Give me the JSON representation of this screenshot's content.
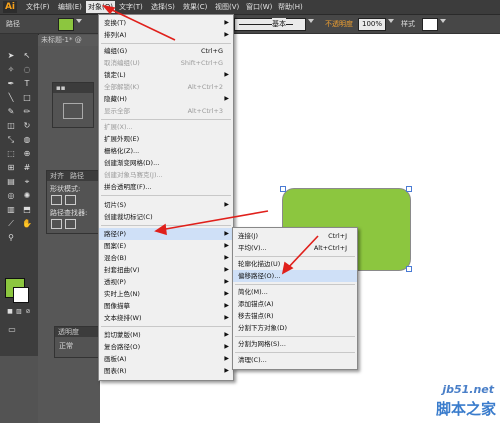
{
  "app": {
    "logo": "Ai"
  },
  "menubar": [
    {
      "label": "文件(F)"
    },
    {
      "label": "编辑(E)"
    },
    {
      "label": "对象(O)"
    },
    {
      "label": "文字(T)"
    },
    {
      "label": "选择(S)"
    },
    {
      "label": "效果(C)"
    },
    {
      "label": "视图(V)"
    },
    {
      "label": "窗口(W)"
    },
    {
      "label": "帮助(H)"
    }
  ],
  "controlbar": {
    "object_type": "路径",
    "stroke_style": "基本",
    "opacity_label": "不透明度",
    "opacity_value": "100%",
    "style_label": "样式"
  },
  "document": {
    "tab_title": "未标题-1* @"
  },
  "panels": {
    "shape_mode_label": "形状模式:",
    "pathfinder_label": "路径查找器:",
    "align_tab": "对齐",
    "path_tab": "路径",
    "transparency_tab": "透明度",
    "blend_mode": "正常"
  },
  "object_menu": {
    "items": [
      {
        "label": "变换(T)",
        "shortcut": "",
        "submenu": true,
        "disabled": false
      },
      {
        "label": "排列(A)",
        "shortcut": "",
        "submenu": true,
        "disabled": false
      },
      {
        "label": "编组(G)",
        "shortcut": "Ctrl+G",
        "submenu": false,
        "disabled": false
      },
      {
        "label": "取消编组(U)",
        "shortcut": "Shift+Ctrl+G",
        "submenu": false,
        "disabled": true
      },
      {
        "label": "锁定(L)",
        "shortcut": "",
        "submenu": true,
        "disabled": false
      },
      {
        "label": "全部解锁(K)",
        "shortcut": "Alt+Ctrl+2",
        "submenu": false,
        "disabled": true
      },
      {
        "label": "隐藏(H)",
        "shortcut": "",
        "submenu": true,
        "disabled": false
      },
      {
        "label": "显示全部",
        "shortcut": "Alt+Ctrl+3",
        "submenu": false,
        "disabled": true
      },
      {
        "label": "扩展(X)...",
        "shortcut": "",
        "submenu": false,
        "disabled": true
      },
      {
        "label": "扩展外观(E)",
        "shortcut": "",
        "submenu": false,
        "disabled": false
      },
      {
        "label": "栅格化(Z)...",
        "shortcut": "",
        "submenu": false,
        "disabled": false
      },
      {
        "label": "创建渐变网格(D)...",
        "shortcut": "",
        "submenu": false,
        "disabled": false
      },
      {
        "label": "创建对象马赛克(J)...",
        "shortcut": "",
        "submenu": false,
        "disabled": true
      },
      {
        "label": "拼合透明度(F)...",
        "shortcut": "",
        "submenu": false,
        "disabled": false
      },
      {
        "label": "切片(S)",
        "shortcut": "",
        "submenu": true,
        "disabled": false
      },
      {
        "label": "创建裁切标记(C)",
        "shortcut": "",
        "submenu": false,
        "disabled": false
      },
      {
        "label": "路径(P)",
        "shortcut": "",
        "submenu": true,
        "disabled": false
      },
      {
        "label": "图案(E)",
        "shortcut": "",
        "submenu": true,
        "disabled": false
      },
      {
        "label": "混合(B)",
        "shortcut": "",
        "submenu": true,
        "disabled": false
      },
      {
        "label": "封套扭曲(V)",
        "shortcut": "",
        "submenu": true,
        "disabled": false
      },
      {
        "label": "透视(P)",
        "shortcut": "",
        "submenu": true,
        "disabled": false
      },
      {
        "label": "实时上色(N)",
        "shortcut": "",
        "submenu": true,
        "disabled": false
      },
      {
        "label": "图像描摹",
        "shortcut": "",
        "submenu": true,
        "disabled": false
      },
      {
        "label": "文本绕排(W)",
        "shortcut": "",
        "submenu": true,
        "disabled": false
      },
      {
        "label": "剪切蒙版(M)",
        "shortcut": "",
        "submenu": true,
        "disabled": false
      },
      {
        "label": "复合路径(O)",
        "shortcut": "",
        "submenu": true,
        "disabled": false
      },
      {
        "label": "画板(A)",
        "shortcut": "",
        "submenu": true,
        "disabled": false
      },
      {
        "label": "图表(R)",
        "shortcut": "",
        "submenu": true,
        "disabled": false
      }
    ]
  },
  "path_submenu": {
    "items": [
      {
        "label": "连接(J)",
        "shortcut": "Ctrl+J"
      },
      {
        "label": "平均(V)...",
        "shortcut": "Alt+Ctrl+J"
      },
      {
        "label": "轮廓化描边(U)",
        "shortcut": ""
      },
      {
        "label": "偏移路径(O)...",
        "shortcut": ""
      },
      {
        "label": "简化(M)...",
        "shortcut": ""
      },
      {
        "label": "添加锚点(A)",
        "shortcut": ""
      },
      {
        "label": "移去锚点(R)",
        "shortcut": ""
      },
      {
        "label": "分割下方对象(D)",
        "shortcut": ""
      },
      {
        "label": "分割为网格(S)...",
        "shortcut": ""
      },
      {
        "label": "清理(C)...",
        "shortcut": ""
      }
    ]
  },
  "watermark": {
    "line1": "jb51.net",
    "line2": "脚本之家"
  },
  "colors": {
    "fill": "#8cc63f",
    "arrow": "#e0201b",
    "highlight": "#cfe0f7"
  }
}
